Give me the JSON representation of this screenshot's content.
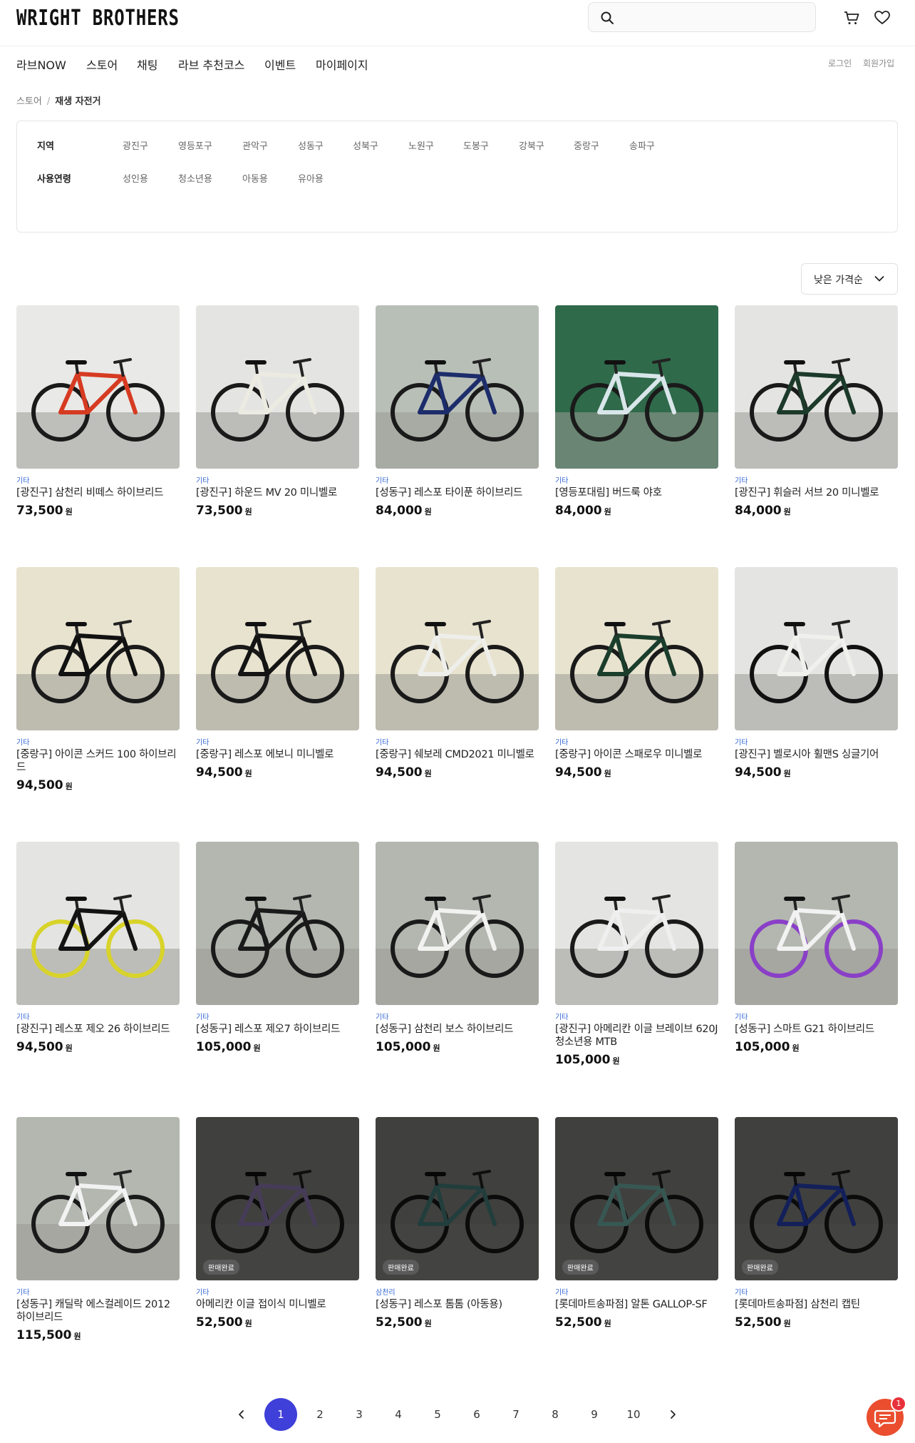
{
  "header": {
    "logo": "WRIGHT BROTHERS",
    "search_placeholder": ""
  },
  "nav": {
    "items": [
      "라브NOW",
      "스토어",
      "채팅",
      "라브 추천코스",
      "이벤트",
      "마이페이지"
    ],
    "login": "로그인",
    "signup": "회원가입"
  },
  "breadcrumb": {
    "root": "스토어",
    "sep": "/",
    "current": "재생 자전거"
  },
  "filter": {
    "region_label": "지역",
    "regions": [
      "광진구",
      "영등포구",
      "관악구",
      "성동구",
      "성북구",
      "노원구",
      "도봉구",
      "강북구",
      "중랑구",
      "송파구"
    ],
    "age_label": "사용연령",
    "ages": [
      "성인용",
      "청소년용",
      "아동용",
      "유아용"
    ]
  },
  "sort": {
    "label": "낮은 가격순"
  },
  "currency": "원",
  "products": [
    {
      "brand": "기타",
      "title": "[광진구] 삼천리 비떼스 하이브리드",
      "price": "73,500",
      "sold": false,
      "frame": "#d63b22",
      "tire": "#1a1a1a",
      "bg": "#e9e9e7"
    },
    {
      "brand": "기타",
      "title": "[광진구] 하운드 MV 20 미니벨로",
      "price": "73,500",
      "sold": false,
      "frame": "#ecebe2",
      "tire": "#1a1a1a",
      "bg": "#e4e4e2"
    },
    {
      "brand": "기타",
      "title": "[성동구] 레스포 타이푼 하이브리드",
      "price": "84,000",
      "sold": false,
      "frame": "#1d2d6b",
      "tire": "#1a1a1a",
      "bg": "#b8bfb7"
    },
    {
      "brand": "기타",
      "title": "[영등포대림] 버드룩 야호",
      "price": "84,000",
      "sold": false,
      "frame": "#d8e6ea",
      "tire": "#1a1a1a",
      "bg": "#2f6a4a"
    },
    {
      "brand": "기타",
      "title": "[광진구] 휘슬러 서브 20 미니벨로",
      "price": "84,000",
      "sold": false,
      "frame": "#1c3a2a",
      "tire": "#1a1a1a",
      "bg": "#e4e4e2"
    },
    {
      "brand": "기타",
      "title": "[중랑구] 아이콘 스커드 100 하이브리드",
      "price": "94,500",
      "sold": false,
      "frame": "#111111",
      "tire": "#1a1a1a",
      "bg": "#e8e3cf"
    },
    {
      "brand": "기타",
      "title": "[중랑구] 레스포 에보니 미니벨로",
      "price": "94,500",
      "sold": false,
      "frame": "#141414",
      "tire": "#1a1a1a",
      "bg": "#e8e3cf"
    },
    {
      "brand": "기타",
      "title": "[중랑구] 쉐보레 CMD2021 미니벨로",
      "price": "94,500",
      "sold": false,
      "frame": "#eeeeea",
      "tire": "#1a1a1a",
      "bg": "#e8e3cf"
    },
    {
      "brand": "기타",
      "title": "[중랑구] 아이콘 스패로우 미니벨로",
      "price": "94,500",
      "sold": false,
      "frame": "#1b3d2c",
      "tire": "#1a1a1a",
      "bg": "#e8e3cf"
    },
    {
      "brand": "기타",
      "title": "[광진구] 벨로시아 휠맨S 싱글기어",
      "price": "94,500",
      "sold": false,
      "frame": "#f0f0ec",
      "tire": "#111111",
      "bg": "#e4e4e2"
    },
    {
      "brand": "기타",
      "title": "[광진구] 레스포 제오 26 하이브리드",
      "price": "94,500",
      "sold": false,
      "frame": "#131313",
      "tire": "#d8d32a",
      "bg": "#e4e4e2"
    },
    {
      "brand": "기타",
      "title": "[성동구] 레스포 제오7 하이브리드",
      "price": "105,000",
      "sold": false,
      "frame": "#1a1a1a",
      "tire": "#1a1a1a",
      "bg": "#b3b7b0"
    },
    {
      "brand": "기타",
      "title": "[성동구] 삼천리 보스 하이브리드",
      "price": "105,000",
      "sold": false,
      "frame": "#f2f2f0",
      "tire": "#1a1a1a",
      "bg": "#b3b7b0"
    },
    {
      "brand": "기타",
      "title": "[광진구] 아메리칸 이글 브레이브 620J 청소년용 MTB",
      "price": "105,000",
      "sold": false,
      "frame": "#efefef",
      "tire": "#1a1a1a",
      "bg": "#e4e4e2"
    },
    {
      "brand": "기타",
      "title": "[성동구] 스마트 G21 하이브리드",
      "price": "105,000",
      "sold": false,
      "frame": "#f2f2f2",
      "tire": "#8a3fc7",
      "bg": "#b3b7b0"
    },
    {
      "brand": "기타",
      "title": "[성동구] 캐딜락 에스컬레이드 2012 하이브리드",
      "price": "115,500",
      "sold": false,
      "frame": "#f2f2f2",
      "tire": "#1a1a1a",
      "bg": "#b3b7b0"
    },
    {
      "brand": "기타",
      "title": "아메리칸 이글 접이식 미니벨로",
      "price": "52,500",
      "sold": true,
      "sold_label": "판매완료",
      "frame": "#9b86c4",
      "tire": "#1a1a1a",
      "bg": "#8e8e8a"
    },
    {
      "brand": "삼천리",
      "title": "[성동구] 레스포 톰톰 (아동용)",
      "price": "52,500",
      "sold": true,
      "sold_label": "판매완료",
      "frame": "#4c8a86",
      "tire": "#1a1a1a",
      "bg": "#8e8e8a"
    },
    {
      "brand": "기타",
      "title": "[롯데마트송파점] 알톤 GALLOP-SF",
      "price": "52,500",
      "sold": true,
      "sold_label": "판매완료",
      "frame": "#7ac0b6",
      "tire": "#1a1a1a",
      "bg": "#8e8e8a"
    },
    {
      "brand": "기타",
      "title": "[롯데마트송파점] 삼천리 캡틴",
      "price": "52,500",
      "sold": true,
      "sold_label": "판매완료",
      "frame": "#2a47c7",
      "tire": "#1a1a1a",
      "bg": "#8e8e8a"
    }
  ],
  "pagination": {
    "pages": [
      "1",
      "2",
      "3",
      "4",
      "5",
      "6",
      "7",
      "8",
      "9",
      "10"
    ],
    "current": "1"
  },
  "chat": {
    "badge": "1"
  }
}
